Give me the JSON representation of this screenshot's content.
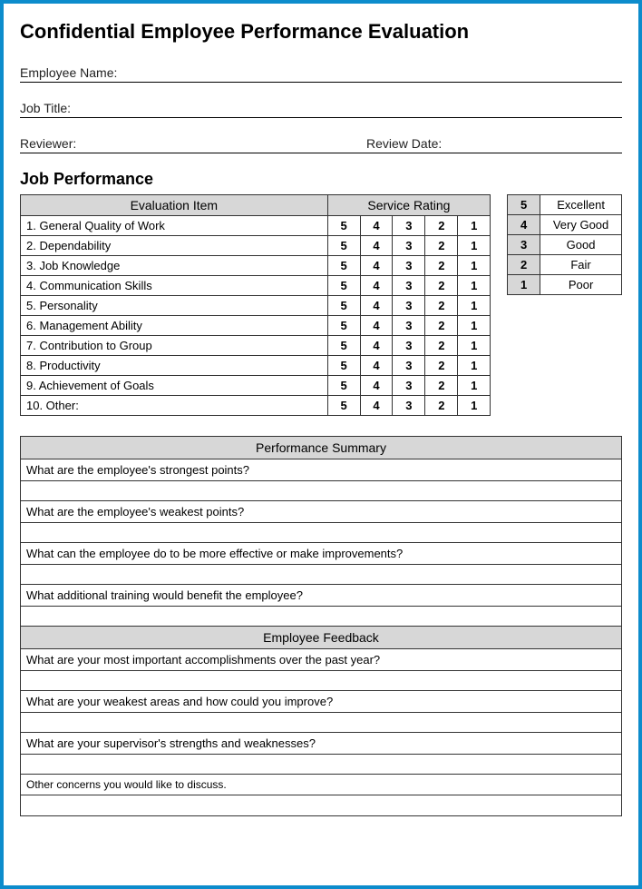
{
  "title": "Confidential Employee Performance Evaluation",
  "fields": {
    "employee_name": "Employee Name:",
    "job_title": "Job Title:",
    "reviewer": "Reviewer:",
    "review_date": "Review Date:"
  },
  "job_performance": {
    "heading": "Job Performance",
    "col_item": "Evaluation  Item",
    "col_rating": "Service Rating",
    "ratings": [
      "5",
      "4",
      "3",
      "2",
      "1"
    ],
    "items": [
      "1.  General Quality of Work",
      "2.  Dependability",
      "3.  Job Knowledge",
      "4.  Communication Skills",
      "5.  Personality",
      "6.  Management Ability",
      "7.  Contribution to Group",
      "8.  Productivity",
      "9.  Achievement of Goals",
      "10. Other:"
    ]
  },
  "legend": [
    {
      "num": "5",
      "desc": "Excellent"
    },
    {
      "num": "4",
      "desc": "Very Good"
    },
    {
      "num": "3",
      "desc": "Good"
    },
    {
      "num": "2",
      "desc": "Fair"
    },
    {
      "num": "1",
      "desc": "Poor"
    }
  ],
  "performance_summary": {
    "title": "Performance Summary",
    "questions": [
      "What are the employee's strongest points?",
      "What are the employee's weakest points?",
      "What can the employee do to be more effective or make improvements?",
      "What additional training would benefit the employee?"
    ]
  },
  "employee_feedback": {
    "title": "Employee Feedback",
    "questions": [
      "What are your most important accomplishments over the past year?",
      "What are your weakest areas and how could you improve?",
      "What are your supervisor's strengths and weaknesses?"
    ],
    "other": "Other concerns you would like to discuss."
  }
}
